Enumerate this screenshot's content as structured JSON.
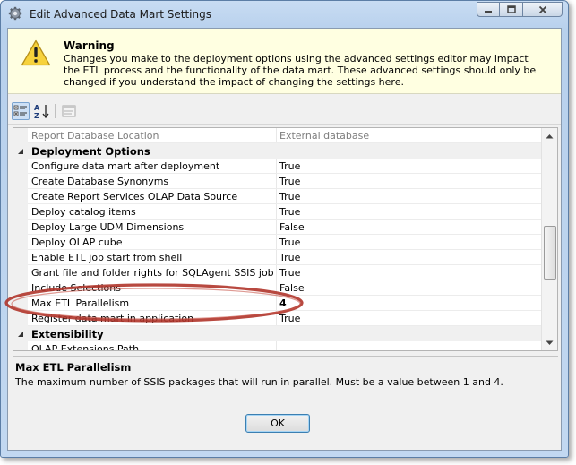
{
  "window": {
    "title": "Edit Advanced Data Mart Settings"
  },
  "warning": {
    "title": "Warning",
    "text": "Changes you make to the deployment options using the advanced settings editor may impact the ETL process and the functionality of the data mart.  These advanced settings should only be changed if you understand the impact of changing the settings here."
  },
  "grid": {
    "rows": [
      {
        "type": "property",
        "name": "Report Database Location",
        "value": "External database",
        "muted": true
      },
      {
        "type": "category",
        "name": "Deployment Options"
      },
      {
        "type": "property",
        "name": "Configure data mart after deployment",
        "value": "True"
      },
      {
        "type": "property",
        "name": "Create Database Synonyms",
        "value": "True"
      },
      {
        "type": "property",
        "name": "Create Report Services OLAP Data Source",
        "value": "True"
      },
      {
        "type": "property",
        "name": "Deploy catalog items",
        "value": "True"
      },
      {
        "type": "property",
        "name": "Deploy Large UDM Dimensions",
        "value": "False"
      },
      {
        "type": "property",
        "name": "Deploy OLAP cube",
        "value": "True"
      },
      {
        "type": "property",
        "name": "Enable ETL job start from shell",
        "value": "True"
      },
      {
        "type": "property",
        "name": "Grant file and folder rights for SQLAgent SSIS job",
        "value": "True"
      },
      {
        "type": "property",
        "name": "Include Selections",
        "value": "False"
      },
      {
        "type": "property",
        "name": "Max ETL Parallelism",
        "value": "4",
        "selected": true
      },
      {
        "type": "property",
        "name": "Register data mart in application",
        "value": "True"
      },
      {
        "type": "category",
        "name": "Extensibility"
      },
      {
        "type": "property",
        "name": "OLAP Extensions Path",
        "value": ""
      }
    ]
  },
  "description": {
    "title": "Max ETL Parallelism",
    "text": "The maximum number of SSIS packages that will run in parallel. Must be a value between 1 and 4."
  },
  "buttons": {
    "ok": "OK"
  },
  "icons": {
    "window": "gear-icon",
    "warning": "warning-triangle-icon",
    "categorized": "categorized-view-icon",
    "alphabetical": "alphabetical-sort-icon",
    "property_pages": "property-pages-icon"
  },
  "colors": {
    "annotation": "#b0352b",
    "warning_bg": "#ffffe1"
  }
}
